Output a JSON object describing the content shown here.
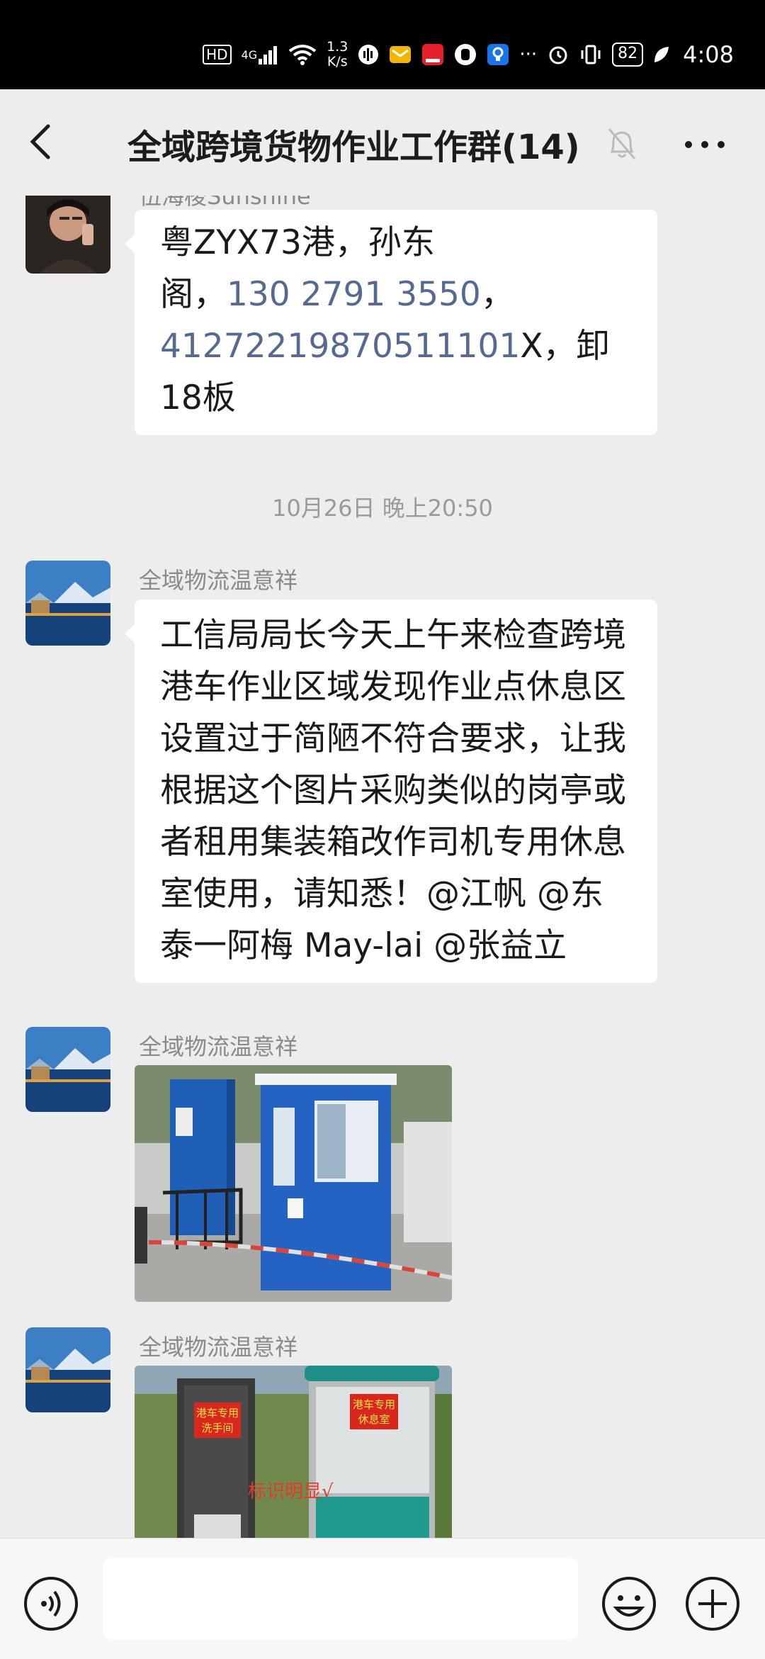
{
  "status_bar": {
    "hd": "HD",
    "net": "4G",
    "speed_value": "1.3",
    "speed_unit": "K/s",
    "battery": "82",
    "time": "4:08"
  },
  "header": {
    "title": "全域跨境货物作业工作群(14)",
    "icons": {
      "back": "back-arrow-icon",
      "mute": "bell-muted-icon",
      "more": "more-dots-icon"
    }
  },
  "messages": [
    {
      "sender": "伍海梭Sunshine",
      "text_plain_1": "粤ZYX73港，孙东\n阁，",
      "phone": "130 2791 3550",
      "sep": "，",
      "id_number": "41272219870511101",
      "text_plain_2": "X，卸\n18板"
    },
    {
      "sender": "全域物流温意祥",
      "text": "工信局局长今天上午来检查跨境港车作业区域发现作业点休息区设置过于简陋不符合要求，让我根据这个图片采购类似的岗亭或者租用集装箱改作司机专用休息室使用，请知悉！@江帆 @东泰一阿梅 May-lai @张益立"
    },
    {
      "sender": "全域物流温意祥",
      "image": "blue-kiosk-photo"
    },
    {
      "sender": "全域物流温意祥",
      "image": "restroom-kiosk-photo",
      "image_text": {
        "sign_left_1": "港车专用",
        "sign_left_2": "洗手间",
        "sign_right_1": "港车专用",
        "sign_right_2": "休息室",
        "overlay": "标识明显√"
      }
    }
  ],
  "time_divider": "10月26日 晚上20:50",
  "input_bar": {
    "placeholder": "",
    "icons": {
      "voice": "voice-icon",
      "emoji": "emoji-icon",
      "plus": "plus-icon"
    }
  }
}
